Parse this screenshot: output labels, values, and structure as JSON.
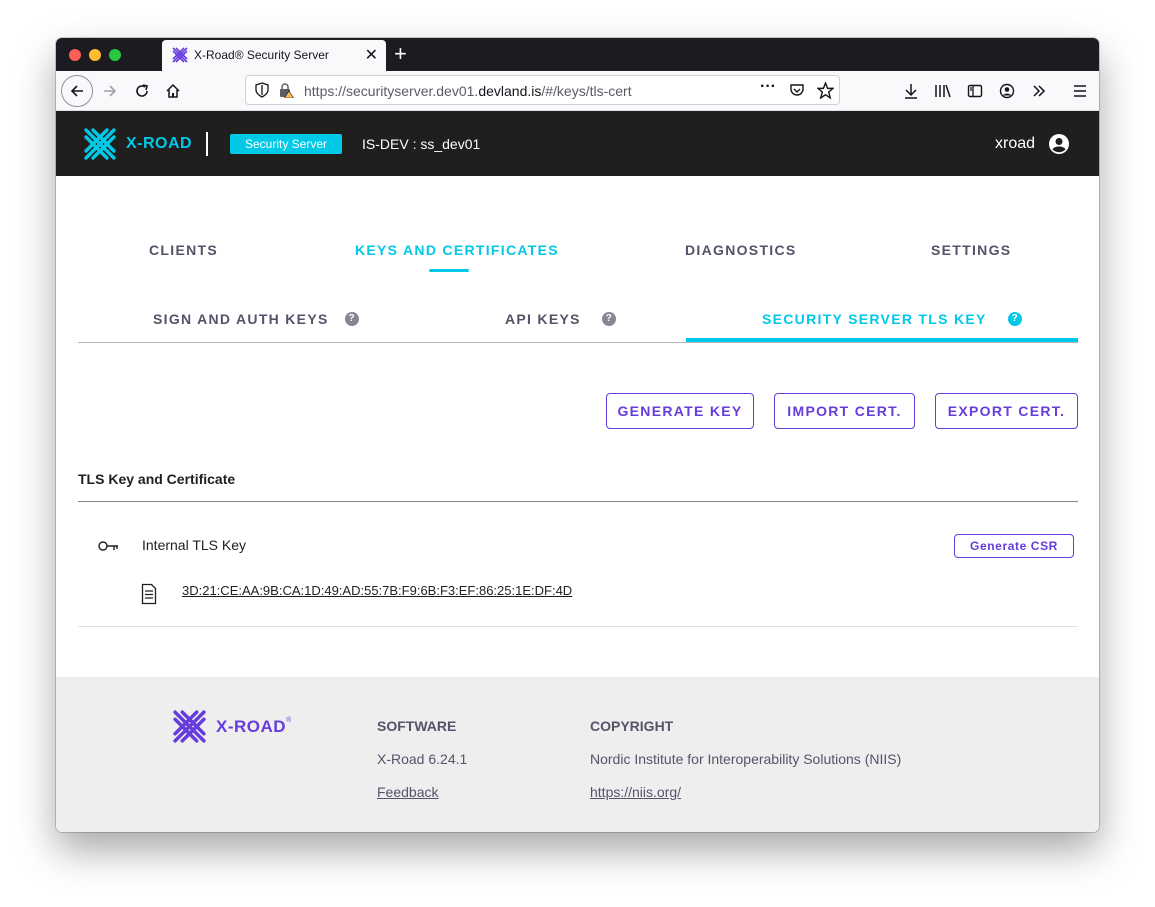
{
  "browser": {
    "tab_title": "X-Road® Security Server",
    "url_prefix": "https://securityserver.dev01.",
    "url_host": "devland.is",
    "url_path": "/#/keys/tls-cert"
  },
  "header": {
    "logo_text": "X-ROAD",
    "server_badge": "Security Server",
    "server_id": "IS-DEV : ss_dev01",
    "username": "xroad"
  },
  "main_tabs": [
    {
      "label": "CLIENTS",
      "active": false
    },
    {
      "label": "KEYS AND CERTIFICATES",
      "active": true
    },
    {
      "label": "DIAGNOSTICS",
      "active": false
    },
    {
      "label": "SETTINGS",
      "active": false
    }
  ],
  "sub_tabs": [
    {
      "label": "SIGN AND AUTH KEYS",
      "active": false
    },
    {
      "label": "API KEYS",
      "active": false
    },
    {
      "label": "SECURITY SERVER TLS KEY",
      "active": true
    }
  ],
  "actions": {
    "generate_key": "GENERATE KEY",
    "import_cert": "IMPORT CERT.",
    "export_cert": "EXPORT CERT."
  },
  "section": {
    "title": "TLS Key and Certificate",
    "key_label": "Internal TLS Key",
    "generate_csr": "Generate CSR",
    "cert_hash": "3D:21:CE:AA:9B:CA:1D:49:AD:55:7B:F9:6B:F3:EF:86:25:1E:DF:4D"
  },
  "footer": {
    "logo_text": "X-ROAD",
    "software_heading": "SOFTWARE",
    "version": "X-Road 6.24.1",
    "feedback": "Feedback",
    "copyright_heading": "COPYRIGHT",
    "copyright_text": "Nordic Institute for Interoperability Solutions (NIIS)",
    "copyright_link": "https://niis.org/"
  },
  "colors": {
    "accent_cyan": "#00c9e7",
    "accent_purple": "#663cdc",
    "header_bg": "#211e1e",
    "footer_bg": "#efeeef"
  }
}
